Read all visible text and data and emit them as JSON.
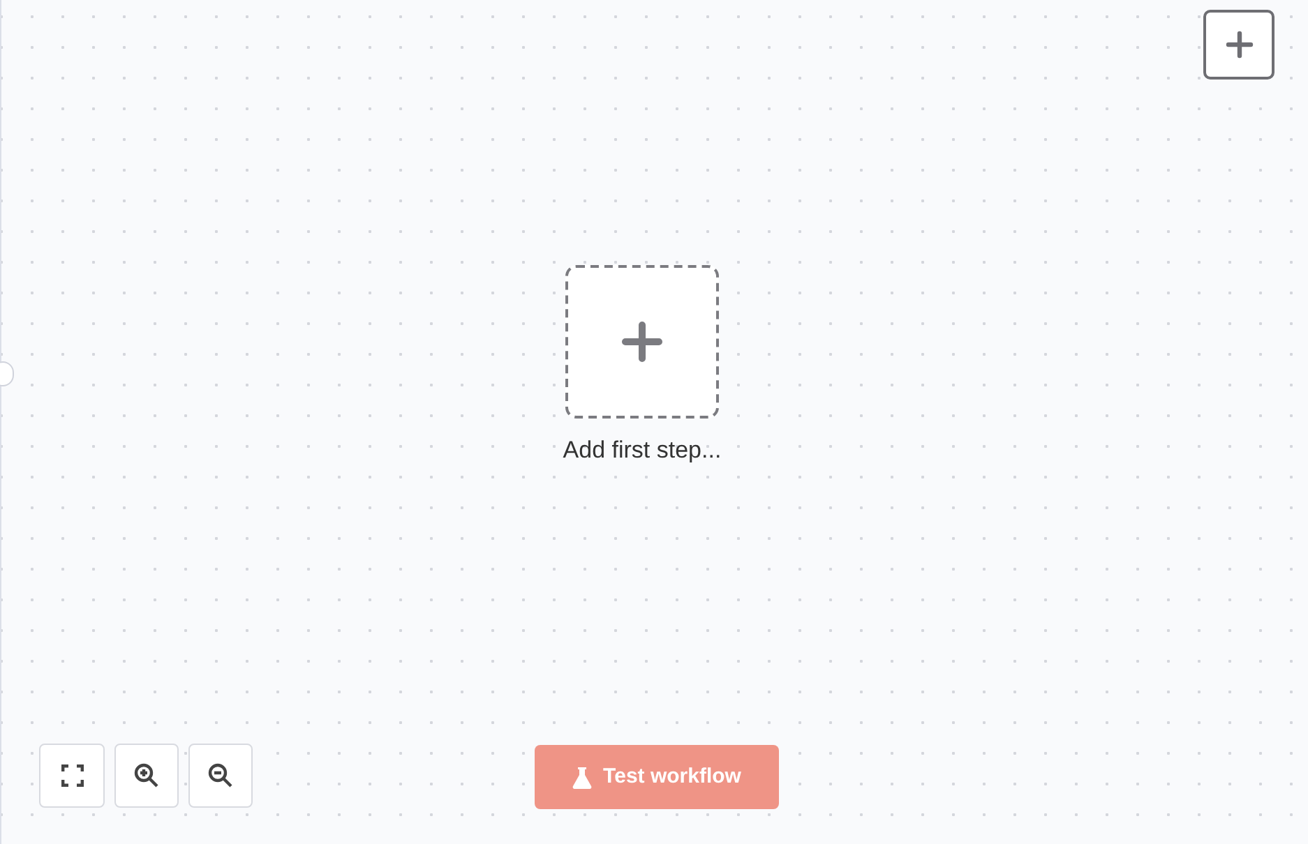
{
  "first_step": {
    "label": "Add first step..."
  },
  "test_button": {
    "label": "Test workflow",
    "disabled": true
  }
}
